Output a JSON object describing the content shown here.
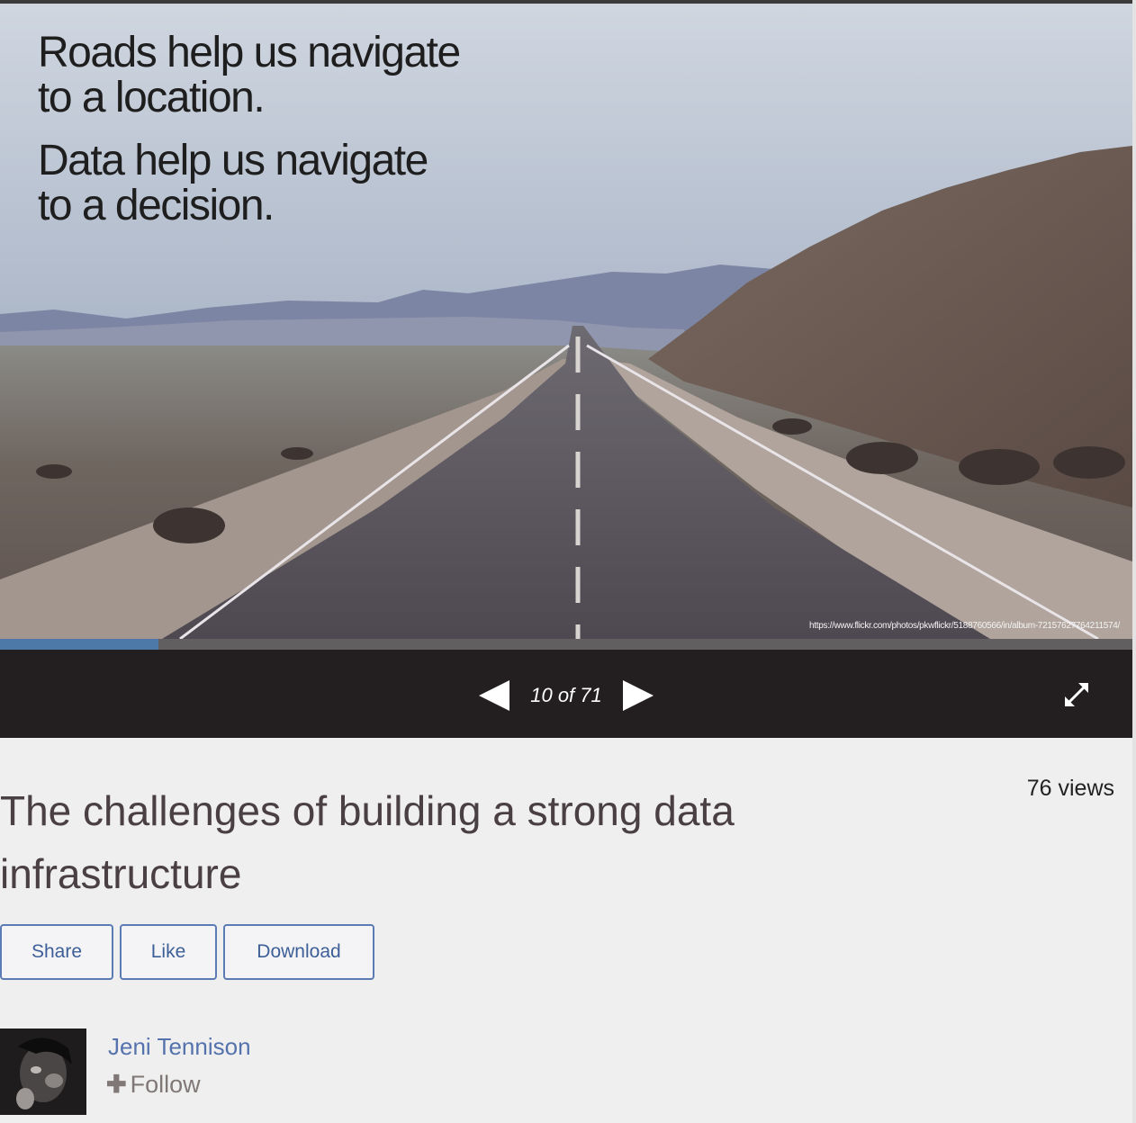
{
  "slide": {
    "line1a": "Roads help us navigate",
    "line1b": "to a location.",
    "line2a": "Data help us navigate",
    "line2b": "to a decision.",
    "photo_credit": "https://www.flickr.com/photos/pkwflickr/5188760566/in/album-72157627764211574/"
  },
  "player": {
    "current_slide": 10,
    "total_slides": 71,
    "page_indicator": "10 of 71",
    "progress_fraction": 0.14
  },
  "presentation": {
    "title": "The challenges of building a strong data infrastructure",
    "views": "76 views"
  },
  "actions": {
    "share_label": "Share",
    "like_label": "Like",
    "download_label": "Download"
  },
  "author": {
    "name": "Jeni Tennison",
    "follow_label": "Follow"
  },
  "colors": {
    "accent": "#5572ad",
    "control_bar": "#231f20",
    "progress": "#4d79a8"
  }
}
